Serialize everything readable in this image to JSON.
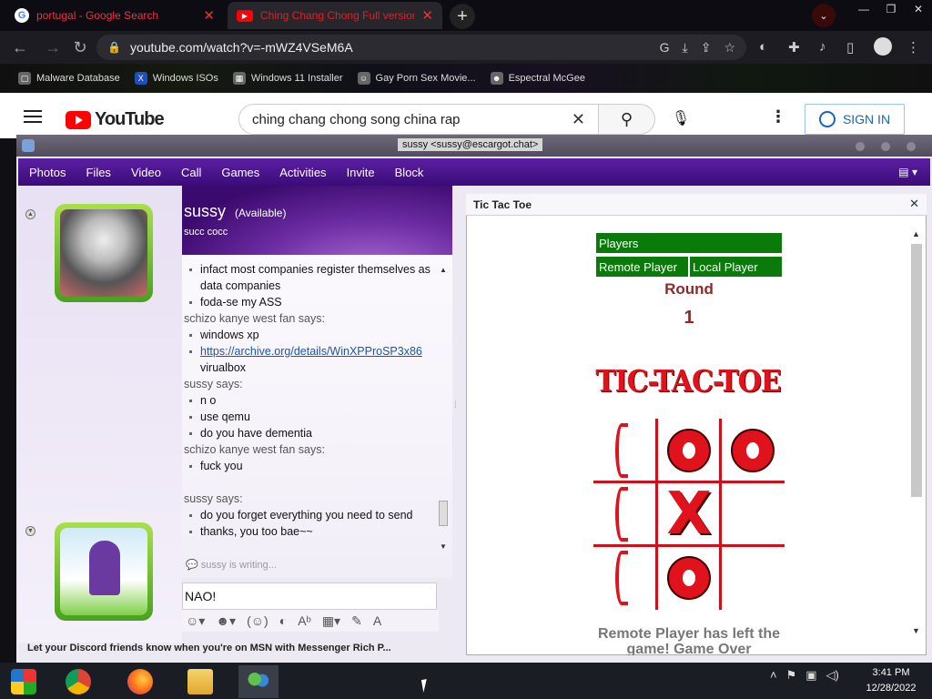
{
  "browser": {
    "tabs": [
      {
        "title": "portugal - Google Search",
        "favicon": "google-icon"
      },
      {
        "title": "Ching Chang Chong Full version (C",
        "favicon": "youtube-icon"
      }
    ],
    "url": "youtube.com/watch?v=-mWZ4VSeM6A",
    "bookmarks": [
      "Malware Database",
      "Windows ISOs",
      "Windows 11 Installer",
      "Gay Porn Sex Movie...",
      "Espectral McGee"
    ]
  },
  "youtube": {
    "logo_text": "YouTube",
    "search_value": "ching chang chong song china rap",
    "signin_label": "SIGN IN"
  },
  "msn": {
    "window_title": "sussy <sussy@escargot.chat>",
    "menu": [
      "Photos",
      "Files",
      "Video",
      "Call",
      "Games",
      "Activities",
      "Invite",
      "Block"
    ],
    "contact": {
      "name": "sussy",
      "status": "(Available)",
      "message": "succ cocc"
    },
    "conversation": [
      {
        "type": "item",
        "text": "infact most companies register themselves as data companies"
      },
      {
        "type": "item",
        "text": "foda-se my ASS"
      },
      {
        "type": "speaker",
        "text": "schizo kanye west fan says:"
      },
      {
        "type": "item",
        "text": " windows xp"
      },
      {
        "type": "link",
        "link": "https://archive.org/details/WinXPProSP3x86",
        "rest": " virualbox"
      },
      {
        "type": "speaker",
        "text": "sussy says:"
      },
      {
        "type": "item",
        "text": "n o"
      },
      {
        "type": "item",
        "text": "use qemu"
      },
      {
        "type": "item",
        "text": "do you have dementia"
      },
      {
        "type": "speaker",
        "text": "schizo kanye west fan says:"
      },
      {
        "type": "item",
        "text": "fuck you"
      },
      {
        "type": "blank",
        "text": ""
      },
      {
        "type": "speaker",
        "text": "sussy says:"
      },
      {
        "type": "item",
        "text": "do you forget everything you need to send"
      },
      {
        "type": "item",
        "text": "thanks, you too bae~~"
      }
    ],
    "typing": "sussy is writing...",
    "input_value": "NAO!",
    "footer_ad": "Let your Discord friends know when you're on MSN with Messenger Rich P..."
  },
  "game": {
    "title": "Tic Tac Toe",
    "players_label": "Players",
    "remote_player": "Remote Player",
    "local_player": "Local Player",
    "round_label": "Round",
    "round_number": "1",
    "logo_text": "TIC-TAC-TOE",
    "board": [
      "partial",
      "O",
      "O",
      "partial",
      "X",
      "",
      "partial",
      "O",
      ""
    ],
    "status": "Remote Player has left the game! Game Over"
  },
  "taskbar": {
    "apps": [
      "chrome-os-icon",
      "chrome-icon",
      "firefox-icon",
      "file-explorer-icon",
      "msn-messenger-icon"
    ],
    "time": "3:41 PM",
    "date": "12/28/2022"
  }
}
